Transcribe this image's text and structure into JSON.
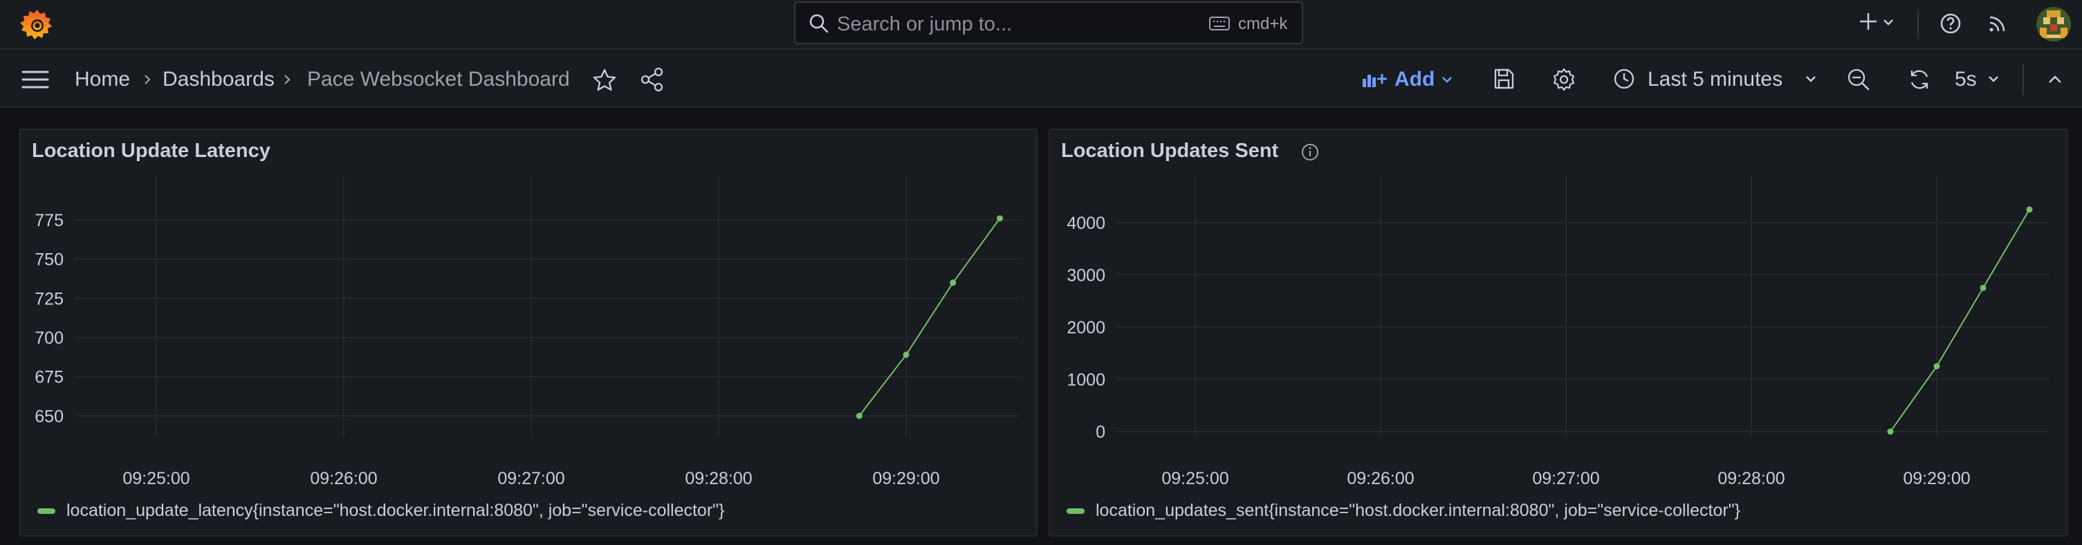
{
  "topbar": {
    "search_placeholder": "Search or jump to...",
    "search_shortcut": "cmd+k",
    "icons": [
      "grafana-logo-icon",
      "search-icon",
      "keyboard-icon",
      "plus-icon",
      "chevron-down-icon",
      "help-icon",
      "rss-icon",
      "avatar"
    ]
  },
  "breadcrumb": {
    "home": "Home",
    "dashboards": "Dashboards",
    "current": "Pace Websocket Dashboard"
  },
  "toolbar": {
    "add_label": "Add",
    "time_range": "Last 5 minutes",
    "refresh_interval": "5s"
  },
  "colors": {
    "background": "#111217",
    "panel": "#181b1f",
    "series": "#73bf69",
    "accent": "#6e9fff"
  },
  "panels": [
    {
      "title": "Location Update Latency",
      "legend": "location_update_latency{instance=\"host.docker.internal:8080\", job=\"service-collector\"}"
    },
    {
      "title": "Location Updates Sent",
      "legend": "location_updates_sent{instance=\"host.docker.internal:8080\", job=\"service-collector\"}"
    }
  ],
  "chart_data": [
    {
      "type": "line",
      "title": "Location Update Latency",
      "x_ticks": [
        "09:25:00",
        "09:26:00",
        "09:27:00",
        "09:28:00",
        "09:29:00"
      ],
      "y_ticks": [
        "650",
        "675",
        "700",
        "725",
        "750",
        "775"
      ],
      "ylim": [
        640,
        790
      ],
      "grid": true,
      "legend_position": "bottom-left",
      "series": [
        {
          "name": "location_update_latency{instance=\"host.docker.internal:8080\", job=\"service-collector\"}",
          "x": [
            "09:28:45",
            "09:29:00",
            "09:29:15",
            "09:29:30"
          ],
          "values": [
            650,
            689,
            735,
            776
          ]
        }
      ]
    },
    {
      "type": "line",
      "title": "Location Updates Sent",
      "x_ticks": [
        "09:25:00",
        "09:26:00",
        "09:27:00",
        "09:28:00",
        "09:29:00"
      ],
      "y_ticks": [
        "0",
        "1000",
        "2000",
        "3000",
        "4000"
      ],
      "ylim": [
        0,
        4500
      ],
      "grid": true,
      "legend_position": "bottom-left",
      "series": [
        {
          "name": "location_updates_sent{instance=\"host.docker.internal:8080\", job=\"service-collector\"}",
          "x": [
            "09:28:45",
            "09:29:00",
            "09:29:15",
            "09:29:30"
          ],
          "values": [
            0,
            1250,
            2750,
            4250
          ]
        }
      ]
    }
  ]
}
